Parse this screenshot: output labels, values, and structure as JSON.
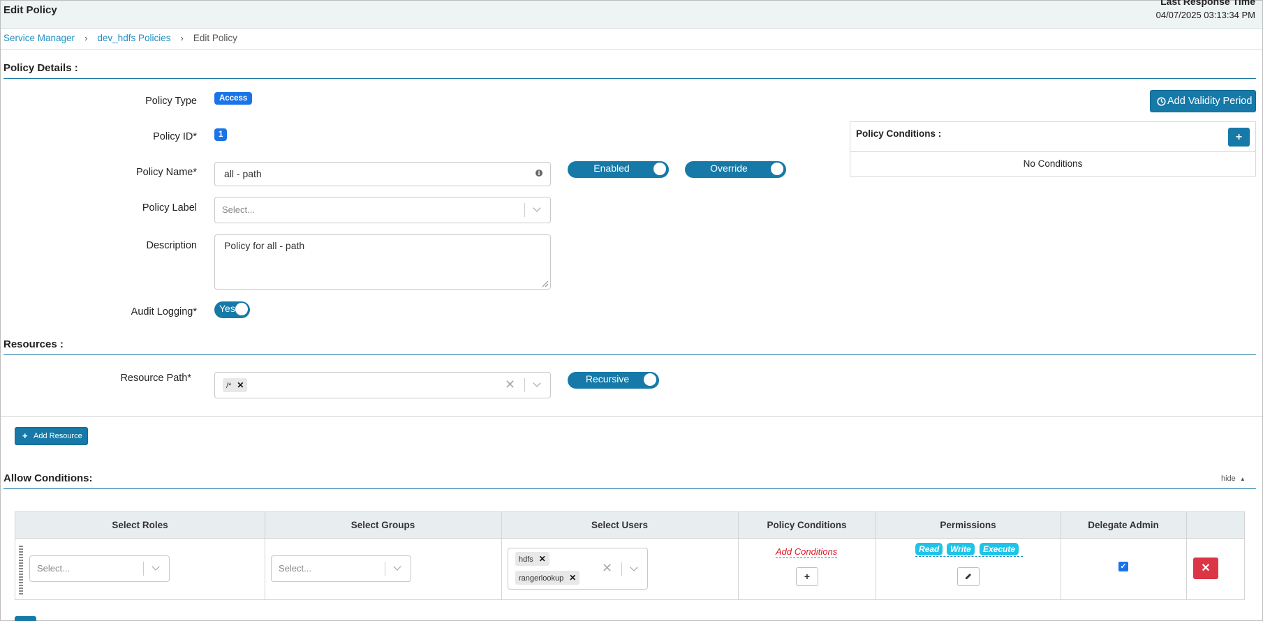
{
  "header": {
    "title": "Edit Policy",
    "last_response_label": "Last Response Time",
    "last_response_time": "04/07/2025 03:13:34 PM"
  },
  "breadcrumb": {
    "items": [
      "Service Manager",
      "dev_hdfs Policies",
      "Edit Policy"
    ],
    "separator": "›"
  },
  "policy_details": {
    "section_title": "Policy Details :",
    "policy_type_label": "Policy Type",
    "policy_type_value": "Access",
    "policy_id_label": "Policy ID*",
    "policy_id_value": "1",
    "policy_name_label": "Policy Name*",
    "policy_name_value": "all - path",
    "enabled_toggle": "Enabled",
    "override_toggle": "Override",
    "policy_label_label": "Policy Label",
    "policy_label_placeholder": "Select...",
    "description_label": "Description",
    "description_value": "Policy for all - path",
    "audit_logging_label": "Audit Logging*",
    "audit_logging_value": "Yes",
    "add_validity_period": "Add Validity Period",
    "policy_conditions_title": "Policy Conditions :",
    "policy_conditions_add": "+",
    "no_conditions": "No Conditions"
  },
  "resources": {
    "section_title": "Resources :",
    "resource_path_label": "Resource Path*",
    "resource_path_tags": [
      "/*"
    ],
    "recursive_toggle": "Recursive",
    "add_resource": "Add Resource"
  },
  "allow_conditions": {
    "section_title": "Allow Conditions:",
    "hide_link": "hide",
    "columns": [
      "Select Roles",
      "Select Groups",
      "Select Users",
      "Policy Conditions",
      "Permissions",
      "Delegate Admin"
    ],
    "rows": [
      {
        "roles_placeholder": "Select...",
        "groups_placeholder": "Select...",
        "users": [
          "hdfs",
          "rangerlookup"
        ],
        "add_conditions": "Add Conditions",
        "permissions": [
          "Read",
          "Write",
          "Execute"
        ],
        "delegate_admin": true
      }
    ]
  },
  "colors": {
    "primary": "#1679a8",
    "badge_blue": "#1a73e8",
    "permission_cyan": "#1fc3e8",
    "danger": "#dc3545",
    "link": "#1f8ec2"
  },
  "icons": {
    "validity": "clock-icon",
    "add": "plus-icon",
    "remove": "close-icon",
    "edit": "pencil-icon",
    "info": "info-icon",
    "dropdown": "chevron-down-icon"
  }
}
